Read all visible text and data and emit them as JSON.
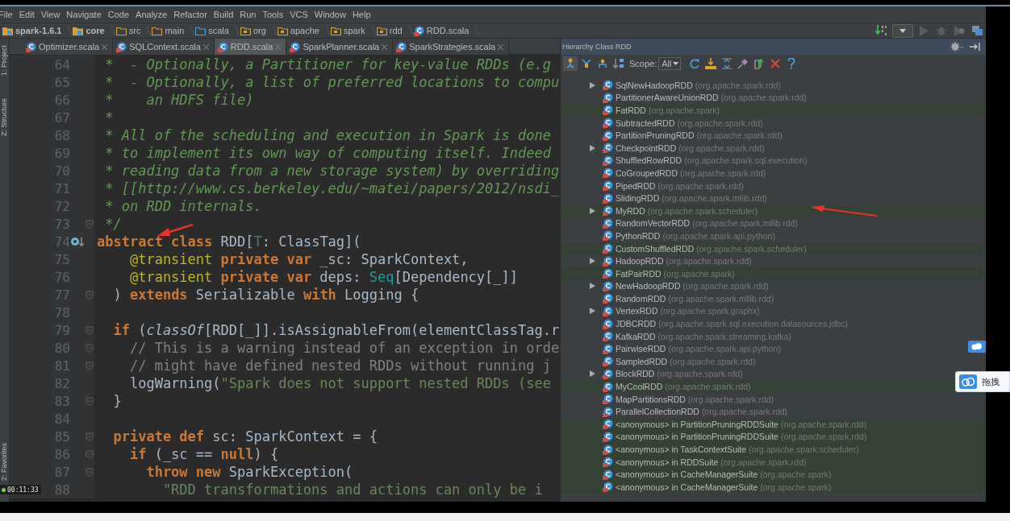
{
  "menu": [
    "File",
    "Edit",
    "View",
    "Navigate",
    "Code",
    "Analyze",
    "Refactor",
    "Build",
    "Run",
    "Tools",
    "VCS",
    "Window",
    "Help"
  ],
  "breadcrumbs": [
    {
      "label": "spark-1.6.1",
      "kind": "module"
    },
    {
      "label": "core",
      "kind": "module"
    },
    {
      "label": "src",
      "kind": "folder"
    },
    {
      "label": "main",
      "kind": "folder"
    },
    {
      "label": "scala",
      "kind": "source"
    },
    {
      "label": "org",
      "kind": "package"
    },
    {
      "label": "apache",
      "kind": "package"
    },
    {
      "label": "spark",
      "kind": "package"
    },
    {
      "label": "rdd",
      "kind": "package"
    },
    {
      "label": "RDD.scala",
      "kind": "file"
    }
  ],
  "tabs": [
    {
      "label": "Optimizer.scala",
      "selected": false
    },
    {
      "label": "SQLContext.scala",
      "selected": false
    },
    {
      "label": "RDD.scala",
      "selected": true
    },
    {
      "label": "SparkPlanner.scala",
      "selected": false
    },
    {
      "label": "SparkStrategies.scala",
      "selected": false
    }
  ],
  "side_tools": [
    "1: Project",
    "Z: Structure",
    "2: Favorites"
  ],
  "editor": {
    "lines": [
      {
        "number": "64",
        "fold": false,
        "override": false,
        "tokens": [
          {
            "kind": "comment",
            "t": " *  - Optionally, a Partitioner for key-value RDDs (e.g"
          }
        ]
      },
      {
        "number": "65",
        "fold": false,
        "override": false,
        "tokens": [
          {
            "kind": "comment",
            "t": " *  - Optionally, a list of preferred locations to compu"
          }
        ]
      },
      {
        "number": "66",
        "fold": false,
        "override": false,
        "tokens": [
          {
            "kind": "comment",
            "t": " *    an HDFS file)"
          }
        ]
      },
      {
        "number": "67",
        "fold": false,
        "override": false,
        "tokens": [
          {
            "kind": "comment",
            "t": " *"
          }
        ]
      },
      {
        "number": "68",
        "fold": false,
        "override": false,
        "tokens": [
          {
            "kind": "comment",
            "t": " * All of the scheduling and execution in Spark is done"
          }
        ]
      },
      {
        "number": "69",
        "fold": false,
        "override": false,
        "tokens": [
          {
            "kind": "comment",
            "t": " * to implement its own way of computing itself. Indeed"
          }
        ]
      },
      {
        "number": "70",
        "fold": false,
        "override": false,
        "tokens": [
          {
            "kind": "comment",
            "t": " * reading data from a new storage system) by overriding"
          }
        ]
      },
      {
        "number": "71",
        "fold": false,
        "override": false,
        "tokens": [
          {
            "kind": "comment",
            "t": " * [[http://www.cs.berkeley.edu/~matei/papers/2012/nsdi_"
          }
        ]
      },
      {
        "number": "72",
        "fold": false,
        "override": false,
        "tokens": [
          {
            "kind": "comment",
            "t": " * on RDD internals."
          }
        ]
      },
      {
        "number": "73",
        "fold": true,
        "override": false,
        "tokens": [
          {
            "kind": "comment",
            "t": " */"
          }
        ]
      },
      {
        "number": "74",
        "fold": false,
        "override": true,
        "tokens": [
          {
            "kind": "keyword",
            "t": "abstract class "
          },
          {
            "kind": "plain",
            "t": "RDD["
          },
          {
            "kind": "typeparam",
            "t": "T"
          },
          {
            "kind": "plain",
            "t": ": ClassTag]("
          }
        ]
      },
      {
        "number": "75",
        "fold": false,
        "override": false,
        "tokens": [
          {
            "kind": "annotation",
            "t": "    @transient "
          },
          {
            "kind": "keyword",
            "t": "private var "
          },
          {
            "kind": "plain",
            "t": "_sc: SparkContext,"
          }
        ]
      },
      {
        "number": "76",
        "fold": false,
        "override": false,
        "tokens": [
          {
            "kind": "annotation",
            "t": "    @transient "
          },
          {
            "kind": "keyword",
            "t": "private var "
          },
          {
            "kind": "plain",
            "t": "deps: "
          },
          {
            "kind": "type",
            "t": "Seq"
          },
          {
            "kind": "plain",
            "t": "[Dependency[_]]"
          }
        ]
      },
      {
        "number": "77",
        "fold": true,
        "override": false,
        "tokens": [
          {
            "kind": "plain",
            "t": "  ) "
          },
          {
            "kind": "keyword",
            "t": "extends "
          },
          {
            "kind": "plain",
            "t": "Serializable "
          },
          {
            "kind": "keyword",
            "t": "with "
          },
          {
            "kind": "plain",
            "t": "Logging {"
          }
        ]
      },
      {
        "number": "78",
        "fold": false,
        "override": false
      },
      {
        "number": "79",
        "fold": true,
        "override": false,
        "tokens": [
          {
            "kind": "keyword",
            "t": "  if "
          },
          {
            "kind": "plain",
            "t": "("
          },
          {
            "kind": "italic",
            "t": "classOf"
          },
          {
            "kind": "plain",
            "t": "[RDD[_]].isAssignableFrom(elementClassTag.r"
          }
        ]
      },
      {
        "number": "80",
        "fold": true,
        "override": false,
        "tokens": [
          {
            "kind": "linecomment",
            "t": "    // This is a warning instead of an exception in orde"
          }
        ]
      },
      {
        "number": "81",
        "fold": true,
        "override": false,
        "tokens": [
          {
            "kind": "linecomment",
            "t": "    // might have defined nested RDDs without running j"
          }
        ]
      },
      {
        "number": "82",
        "fold": false,
        "override": false,
        "tokens": [
          {
            "kind": "plain",
            "t": "    logWarning("
          },
          {
            "kind": "string",
            "t": "\"Spark does not support nested RDDs (see"
          }
        ]
      },
      {
        "number": "83",
        "fold": true,
        "override": false,
        "tokens": [
          {
            "kind": "plain",
            "t": "  }"
          }
        ]
      },
      {
        "number": "84",
        "fold": false,
        "override": false
      },
      {
        "number": "85",
        "fold": true,
        "override": false,
        "tokens": [
          {
            "kind": "keyword",
            "t": "  private def "
          },
          {
            "kind": "plain",
            "t": "sc: SparkContext = {"
          }
        ]
      },
      {
        "number": "86",
        "fold": true,
        "override": false,
        "tokens": [
          {
            "kind": "keyword",
            "t": "    if "
          },
          {
            "kind": "plain",
            "t": "(_sc == "
          },
          {
            "kind": "keyword",
            "t": "null"
          },
          {
            "kind": "plain",
            "t": ") {"
          }
        ]
      },
      {
        "number": "87",
        "fold": true,
        "override": false,
        "tokens": [
          {
            "kind": "keyword",
            "t": "      throw new "
          },
          {
            "kind": "plain",
            "t": "SparkException("
          }
        ]
      },
      {
        "number": "88",
        "fold": false,
        "override": false,
        "tokens": [
          {
            "kind": "string",
            "t": "        \"RDD transformations and actions can only be i"
          }
        ]
      }
    ]
  },
  "hierarchy": {
    "title": "Hierarchy Class RDD",
    "scope_label": "Scope:",
    "scope": "All",
    "rows": [
      {
        "name": "SqlNewHadoopRDD",
        "package": "(org.apache.spark.rdd)",
        "expandable": true,
        "highlighted": false
      },
      {
        "name": "PartitionerAwareUnionRDD",
        "package": "(org.apache.spark.rdd)",
        "expandable": false,
        "highlighted": false
      },
      {
        "name": "FatRDD",
        "package": "(org.apache.spark)",
        "expandable": false,
        "highlighted": true
      },
      {
        "name": "SubtractedRDD",
        "package": "(org.apache.spark.rdd)",
        "expandable": false,
        "highlighted": false
      },
      {
        "name": "PartitionPruningRDD",
        "package": "(org.apache.spark.rdd)",
        "expandable": false,
        "highlighted": false
      },
      {
        "name": "CheckpointRDD",
        "package": "(org.apache.spark.rdd)",
        "expandable": true,
        "highlighted": false
      },
      {
        "name": "ShuffledRowRDD",
        "package": "(org.apache.spark.sql.execution)",
        "expandable": false,
        "highlighted": false
      },
      {
        "name": "CoGroupedRDD",
        "package": "(org.apache.spark.rdd)",
        "expandable": false,
        "highlighted": false
      },
      {
        "name": "PipedRDD",
        "package": "(org.apache.spark.rdd)",
        "expandable": false,
        "highlighted": false
      },
      {
        "name": "SlidingRDD",
        "package": "(org.apache.spark.mllib.rdd)",
        "expandable": false,
        "highlighted": false
      },
      {
        "name": "MyRDD",
        "package": "(org.apache.spark.scheduler)",
        "expandable": true,
        "highlighted": true
      },
      {
        "name": "RandomVectorRDD",
        "package": "(org.apache.spark.mllib.rdd)",
        "expandable": false,
        "highlighted": false
      },
      {
        "name": "PythonRDD",
        "package": "(org.apache.spark.api.python)",
        "expandable": false,
        "highlighted": false
      },
      {
        "name": "CustomShuffledRDD",
        "package": "(org.apache.spark.scheduler)",
        "expandable": false,
        "highlighted": true
      },
      {
        "name": "HadoopRDD",
        "package": "(org.apache.spark.rdd)",
        "expandable": true,
        "highlighted": false
      },
      {
        "name": "FatPairRDD",
        "package": "(org.apache.spark)",
        "expandable": false,
        "highlighted": true
      },
      {
        "name": "NewHadoopRDD",
        "package": "(org.apache.spark.rdd)",
        "expandable": true,
        "highlighted": false
      },
      {
        "name": "RandomRDD",
        "package": "(org.apache.spark.mllib.rdd)",
        "expandable": false,
        "highlighted": false
      },
      {
        "name": "VertexRDD",
        "package": "(org.apache.spark.graphx)",
        "expandable": true,
        "highlighted": false
      },
      {
        "name": "JDBCRDD",
        "package": "(org.apache.spark.sql.execution.datasources.jdbc)",
        "expandable": false,
        "highlighted": false
      },
      {
        "name": "KafkaRDD",
        "package": "(org.apache.spark.streaming.kafka)",
        "expandable": false,
        "highlighted": false
      },
      {
        "name": "PairwiseRDD",
        "package": "(org.apache.spark.api.python)",
        "expandable": false,
        "highlighted": false
      },
      {
        "name": "SampledRDD",
        "package": "(org.apache.spark.rdd)",
        "expandable": false,
        "highlighted": false
      },
      {
        "name": "BlockRDD",
        "package": "(org.apache.spark.rdd)",
        "expandable": true,
        "highlighted": false
      },
      {
        "name": "MyCoolRDD",
        "package": "(org.apache.spark.rdd)",
        "expandable": false,
        "highlighted": true
      },
      {
        "name": "MapPartitionsRDD",
        "package": "(org.apache.spark.rdd)",
        "expandable": false,
        "highlighted": false
      },
      {
        "name": "ParallelCollectionRDD",
        "package": "(org.apache.spark.rdd)",
        "expandable": false,
        "highlighted": false
      },
      {
        "name": "<anonymous> in PartitionPruningRDDSuite",
        "package": "(org.apache.spark.rdd)",
        "expandable": false,
        "highlighted": true
      },
      {
        "name": "<anonymous> in PartitionPruningRDDSuite",
        "package": "(org.apache.spark.rdd)",
        "expandable": false,
        "highlighted": true
      },
      {
        "name": "<anonymous> in TaskContextSuite",
        "package": "(org.apache.spark.scheduler)",
        "expandable": false,
        "highlighted": true
      },
      {
        "name": "<anonymous> in RDDSuite",
        "package": "(org.apache.spark.rdd)",
        "expandable": false,
        "highlighted": true
      },
      {
        "name": "<anonymous> in CacheManagerSuite",
        "package": "(org.apache.spark)",
        "expandable": false,
        "highlighted": true
      },
      {
        "name": "<anonymous> in CacheManagerSuite",
        "package": "(org.apache.spark)",
        "expandable": false,
        "highlighted": true
      }
    ]
  },
  "player": {
    "time": "00:11:33"
  },
  "float_button": {
    "label": "拖拽"
  }
}
